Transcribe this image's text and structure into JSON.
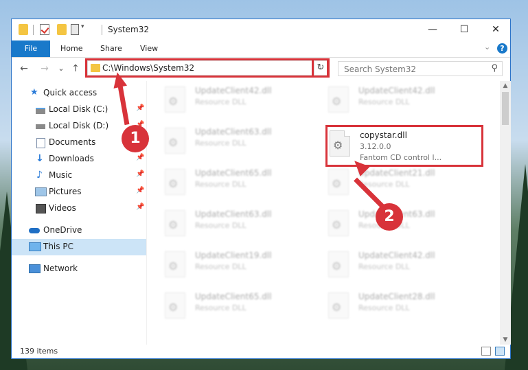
{
  "window": {
    "title": "System32",
    "controls": {
      "minimize": "—",
      "maximize": "☐",
      "close": "✕"
    }
  },
  "ribbon": {
    "tabs": [
      "File",
      "Home",
      "Share",
      "View"
    ],
    "expand_glyph": "⌄",
    "help_glyph": "?"
  },
  "nav": {
    "back": "←",
    "forward": "→",
    "recent": "⌄",
    "up": "↑",
    "address": "C:\\Windows\\System32",
    "address_dropdown": "⌄",
    "refresh": "↻",
    "search_placeholder": "Search System32",
    "search_glyph": "⚲"
  },
  "sidebar": {
    "items": [
      {
        "label": "Quick access",
        "icon": "star-icon",
        "pinned": false
      },
      {
        "label": "Local Disk (C:)",
        "icon": "drive-icon",
        "pinned": true
      },
      {
        "label": "Local Disk (D:)",
        "icon": "drive-icon",
        "pinned": true
      },
      {
        "label": "Documents",
        "icon": "documents-icon",
        "pinned": true
      },
      {
        "label": "Downloads",
        "icon": "download-icon",
        "pinned": true
      },
      {
        "label": "Music",
        "icon": "music-icon",
        "pinned": true
      },
      {
        "label": "Pictures",
        "icon": "pictures-icon",
        "pinned": true
      },
      {
        "label": "Videos",
        "icon": "videos-icon",
        "pinned": true
      },
      {
        "label": "OneDrive",
        "icon": "cloud-icon",
        "pinned": false
      },
      {
        "label": "This PC",
        "icon": "pc-icon",
        "pinned": false,
        "selected": true
      },
      {
        "label": "Network",
        "icon": "network-icon",
        "pinned": false
      }
    ],
    "pin_glyph": "📌"
  },
  "files": {
    "left_column": [
      {
        "name": "UpdateClient42.dll",
        "type": "Resource DLL"
      },
      {
        "name": "UpdateClient63.dll",
        "type": "Resource DLL"
      },
      {
        "name": "UpdateClient65.dll",
        "type": "Resource DLL"
      },
      {
        "name": "UpdateClient63.dll",
        "type": "Resource DLL"
      },
      {
        "name": "UpdateClient19.dll",
        "type": "Resource DLL"
      },
      {
        "name": "UpdateClient65.dll",
        "type": "Resource DLL"
      }
    ],
    "right_column": [
      {
        "name": "UpdateClient42.dll",
        "type": "Resource DLL"
      },
      {
        "name": "UpdateClient21.dll",
        "type": "Resource DLL"
      },
      {
        "name": "UpdateClient63.dll",
        "type": "Resource DLL"
      },
      {
        "name": "UpdateClient42.dll",
        "type": "Resource DLL"
      },
      {
        "name": "UpdateClient28.dll",
        "type": "Resource DLL"
      }
    ],
    "highlighted": {
      "name": "copystar.dll",
      "version": "3.12.0.0",
      "description": "Fantom CD control l..."
    }
  },
  "status": {
    "item_count": "139 items"
  },
  "callouts": {
    "step1": "1",
    "step2": "2"
  },
  "colors": {
    "accent": "#1979ca",
    "highlight": "#d8333a",
    "selected": "#cce4f7"
  }
}
